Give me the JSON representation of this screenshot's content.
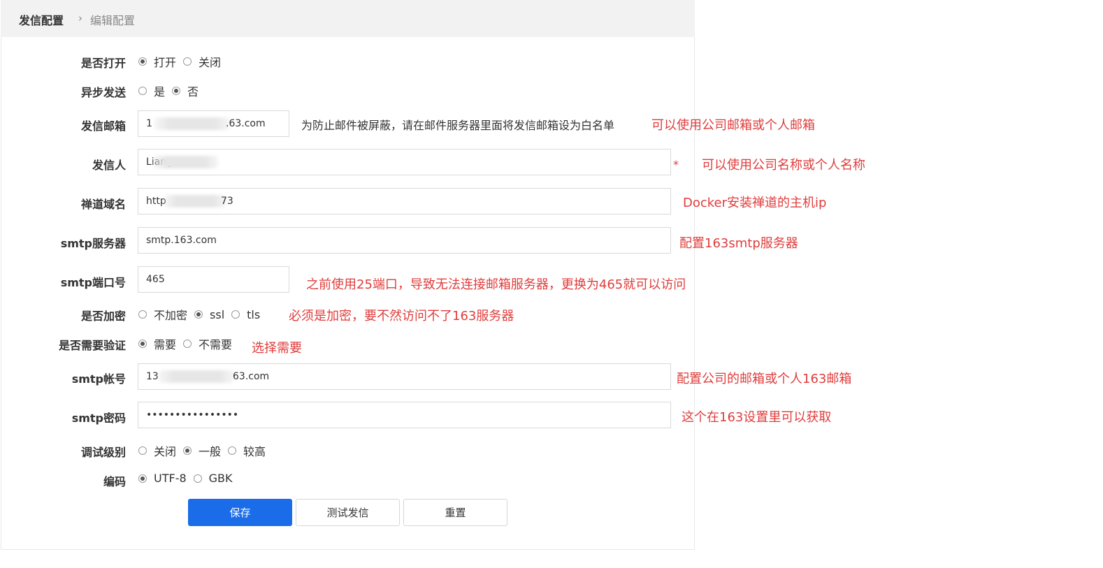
{
  "breadcrumb": {
    "main": "发信配置",
    "separator": "›",
    "sub": "编辑配置"
  },
  "form": {
    "enabled": {
      "label": "是否打开",
      "options": [
        "打开",
        "关闭"
      ],
      "selected": 0
    },
    "async": {
      "label": "异步发送",
      "options": [
        "是",
        "否"
      ],
      "selected": 1
    },
    "sender_email": {
      "label": "发信邮箱",
      "value_start": "1",
      "value_end": ".63.com",
      "hint": "为防止邮件被屏蔽，请在邮件服务器里面将发信邮箱设为白名单"
    },
    "sender_name": {
      "label": "发信人",
      "value_start": "Liang",
      "required_mark": "*"
    },
    "domain": {
      "label": "禅道域名",
      "value_start": "http",
      "value_end": "73"
    },
    "smtp_server": {
      "label": "smtp服务器",
      "value": "smtp.163.com"
    },
    "smtp_port": {
      "label": "smtp端口号",
      "value": "465"
    },
    "encryption": {
      "label": "是否加密",
      "options": [
        "不加密",
        "ssl",
        "tls"
      ],
      "selected": 1
    },
    "auth": {
      "label": "是否需要验证",
      "options": [
        "需要",
        "不需要"
      ],
      "selected": 0
    },
    "smtp_account": {
      "label": "smtp帐号",
      "value_start": "13",
      "value_end": "63.com"
    },
    "smtp_password": {
      "label": "smtp密码",
      "value": "••••••••••••••••"
    },
    "debug": {
      "label": "调试级别",
      "options": [
        "关闭",
        "一般",
        "较高"
      ],
      "selected": 1
    },
    "charset": {
      "label": "编码",
      "options": [
        "UTF-8",
        "GBK"
      ],
      "selected": 0
    }
  },
  "buttons": {
    "save": "保存",
    "test": "测试发信",
    "reset": "重置"
  },
  "notes": {
    "sender_email": "可以使用公司邮箱或个人邮箱",
    "sender_name": "可以使用公司名称或个人名称",
    "domain": "Docker安装禅道的主机ip",
    "smtp_server": "配置163smtp服务器",
    "smtp_port": "之前使用25端口，导致无法连接邮箱服务器，更换为465就可以访问",
    "encryption": "必须是加密，要不然访问不了163服务器",
    "auth": "选择需要",
    "smtp_account": "配置公司的邮箱或个人163邮箱",
    "smtp_password": "这个在163设置里可以获取"
  },
  "colors": {
    "primary": "#1a6ce8",
    "annotation": "#e03c3c",
    "header_bg": "#f2f2f2"
  }
}
